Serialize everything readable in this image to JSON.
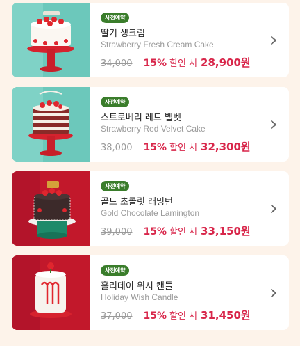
{
  "products": [
    {
      "badge": "사전예약",
      "name_ko": "딸기 생크림",
      "name_en": "Strawberry Fresh Cream Cake",
      "original_price": "34,000",
      "discount_pct": "15%",
      "discount_text": "할인 시",
      "final_price": "28,900원",
      "thumb_bg": "#6cc8bb",
      "cake": "strawberry-cream-cake-image"
    },
    {
      "badge": "사전예약",
      "name_ko": "스트로베리 레드 벨벳",
      "name_en": "Strawberry Red Velvet Cake",
      "original_price": "38,000",
      "discount_pct": "15%",
      "discount_text": "할인 시",
      "final_price": "32,300원",
      "thumb_bg": "#6cc8bb",
      "cake": "red-velvet-cake-image"
    },
    {
      "badge": "사전예약",
      "name_ko": "골드 초콜릿 래밍턴",
      "name_en": "Gold Chocolate Lamington",
      "original_price": "39,000",
      "discount_pct": "15%",
      "discount_text": "할인 시",
      "final_price": "33,150원",
      "thumb_bg": "#c2182b",
      "cake": "chocolate-lamington-cake-image"
    },
    {
      "badge": "사전예약",
      "name_ko": "홀리데이 위시 캔들",
      "name_en": "Holiday Wish Candle",
      "original_price": "37,000",
      "discount_pct": "15%",
      "discount_text": "할인 시",
      "final_price": "31,450원",
      "thumb_bg": "#c2182b",
      "cake": "wish-candle-cake-image"
    }
  ],
  "colors": {
    "accent": "#d8264a",
    "badge": "#3a7d2b",
    "background": "#fdf3ea"
  },
  "icons": {
    "chevron": "chevron-right-icon"
  }
}
